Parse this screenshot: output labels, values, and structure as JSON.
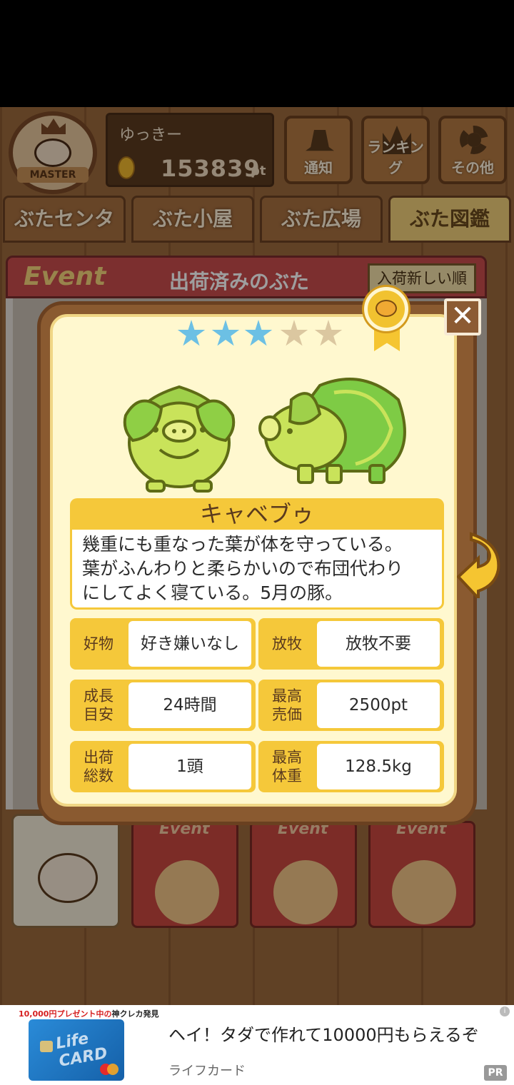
{
  "user": {
    "name": "ゆっきー",
    "points": "153839",
    "points_unit": "pt",
    "badge": "MASTER"
  },
  "header_buttons": [
    {
      "label": "通知",
      "icon": "bell-icon"
    },
    {
      "label": "ランキング",
      "icon": "crown-icon"
    },
    {
      "label": "その他",
      "icon": "gear-icon"
    }
  ],
  "tabs": [
    {
      "label": "ぶたセンター",
      "active": false
    },
    {
      "label": "ぶた小屋",
      "active": false
    },
    {
      "label": "ぶた広場",
      "active": false
    },
    {
      "label": "ぶた図鑑",
      "active": true
    }
  ],
  "event_panel": {
    "logo": "Event",
    "title": "出荷済みのぶた",
    "sort_label": "入荷新しい順"
  },
  "bottom_cards": [
    {
      "tag": "Event"
    },
    {
      "tag": "Event"
    },
    {
      "tag": "Event"
    }
  ],
  "modal": {
    "rarity": 3,
    "max_rarity": 5,
    "close_label": "✕",
    "pig_name": "キャベブゥ",
    "description": [
      "幾重にも重なった葉が体を守っている。",
      "葉がふんわりと柔らかいので布団代わり",
      "にしてよく寝ている。5月の豚。"
    ],
    "stats": [
      {
        "key": "好物",
        "value": "好き嫌いなし"
      },
      {
        "key": "放牧",
        "value": "放牧不要"
      },
      {
        "key": "成長\n目安",
        "value": "24時間"
      },
      {
        "key": "最高\n売価",
        "value": "2500pt"
      },
      {
        "key": "出荷\n総数",
        "value": "1頭"
      },
      {
        "key": "最高\n体重",
        "value": "128.5kg"
      }
    ]
  },
  "ad": {
    "promo_amount": "10,000",
    "promo_text": "円プレゼント中の",
    "promo_suffix": "神クレカ発見",
    "card_text": "Life CARD",
    "headline": "ヘイ！タダで作れて10000円もらえるぞ",
    "brand": "ライフカード",
    "pr_label": "PR",
    "info_label": "i"
  },
  "colors": {
    "panel_yellow": "#f5c83a",
    "modal_bg": "#fff8cf",
    "star_on": "#6cc0e4",
    "star_off": "#dbc7a0",
    "wood": "#8a5a30"
  }
}
